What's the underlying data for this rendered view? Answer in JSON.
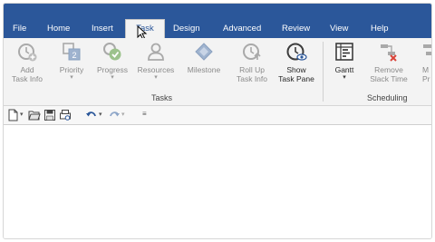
{
  "tabs": [
    {
      "label": "File"
    },
    {
      "label": "Home"
    },
    {
      "label": "Insert"
    },
    {
      "label": "Task"
    },
    {
      "label": "Design"
    },
    {
      "label": "Advanced"
    },
    {
      "label": "Review"
    },
    {
      "label": "View"
    },
    {
      "label": "Help"
    }
  ],
  "active_tab": "Task",
  "ribbon": {
    "tasks_group": {
      "label": "Tasks",
      "buttons": [
        {
          "line1": "Add",
          "line2": "Task Info",
          "icon": "add-task-info-icon",
          "enabled": false
        },
        {
          "line1": "Priority",
          "line2": "",
          "icon": "priority-icon",
          "enabled": false,
          "dropdown": true
        },
        {
          "line1": "Progress",
          "line2": "",
          "icon": "progress-icon",
          "enabled": false,
          "dropdown": true
        },
        {
          "line1": "Resources",
          "line2": "",
          "icon": "resources-icon",
          "enabled": false,
          "dropdown": true
        },
        {
          "line1": "Milestone",
          "line2": "",
          "icon": "milestone-icon",
          "enabled": false
        },
        {
          "line1": "Roll Up",
          "line2": "Task Info",
          "icon": "roll-up-icon",
          "enabled": false
        },
        {
          "line1": "Show",
          "line2": "Task Pane",
          "icon": "show-task-pane-icon",
          "enabled": true
        }
      ]
    },
    "scheduling_group": {
      "label": "Scheduling",
      "buttons": [
        {
          "line1": "Gantt",
          "line2": "",
          "icon": "gantt-icon",
          "enabled": true,
          "dropdown": true
        },
        {
          "line1": "Remove",
          "line2": "Slack Time",
          "icon": "remove-slack-time-icon",
          "enabled": false,
          "dropdown": true
        },
        {
          "line1": "M",
          "line2": "Pr",
          "icon": "partial-icon",
          "enabled": false
        }
      ]
    }
  },
  "quick_access": [
    "new-document-icon",
    "open-folder-icon",
    "save-icon",
    "print-preview-icon",
    "undo-icon",
    "redo-icon",
    "customize-qat-icon"
  ],
  "colors": {
    "tab_bar": "#2b579a",
    "ribbon_bg": "#f3f3f3",
    "icon_disabled": "#a9a9a9",
    "icon_enabled": "#3c3c3c",
    "accent_blue": "#4a7bbf",
    "accent_green": "#6aa84f",
    "accent_red": "#d9443a"
  }
}
